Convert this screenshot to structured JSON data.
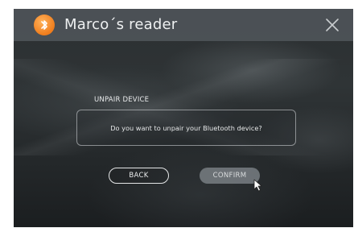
{
  "window": {
    "title": "Marco´s reader"
  },
  "icons": {
    "app": "bluetooth-icon",
    "close": "close-icon",
    "cursor": "mouse-pointer-icon"
  },
  "colors": {
    "accent": "#f07d1c",
    "titlebar": "#4e5458",
    "text": "#eef0f1"
  },
  "dialog": {
    "section_label": "UNPAIR DEVICE",
    "message": "Do you want to unpair your Bluetooth device?",
    "back_label": "BACK",
    "confirm_label": "CONFIRM"
  }
}
